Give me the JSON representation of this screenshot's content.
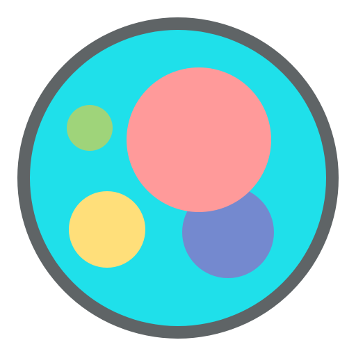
{
  "icon": {
    "name": "app-icon-bubbles",
    "colors": {
      "background": "#ffffff",
      "ring": "#5f6466",
      "base": "#1fe0ea",
      "bubble_pink": "#ff9a9a",
      "bubble_purple": "#7489cf",
      "bubble_yellow": "#ffdf7a",
      "bubble_green": "#9fd47a"
    }
  }
}
